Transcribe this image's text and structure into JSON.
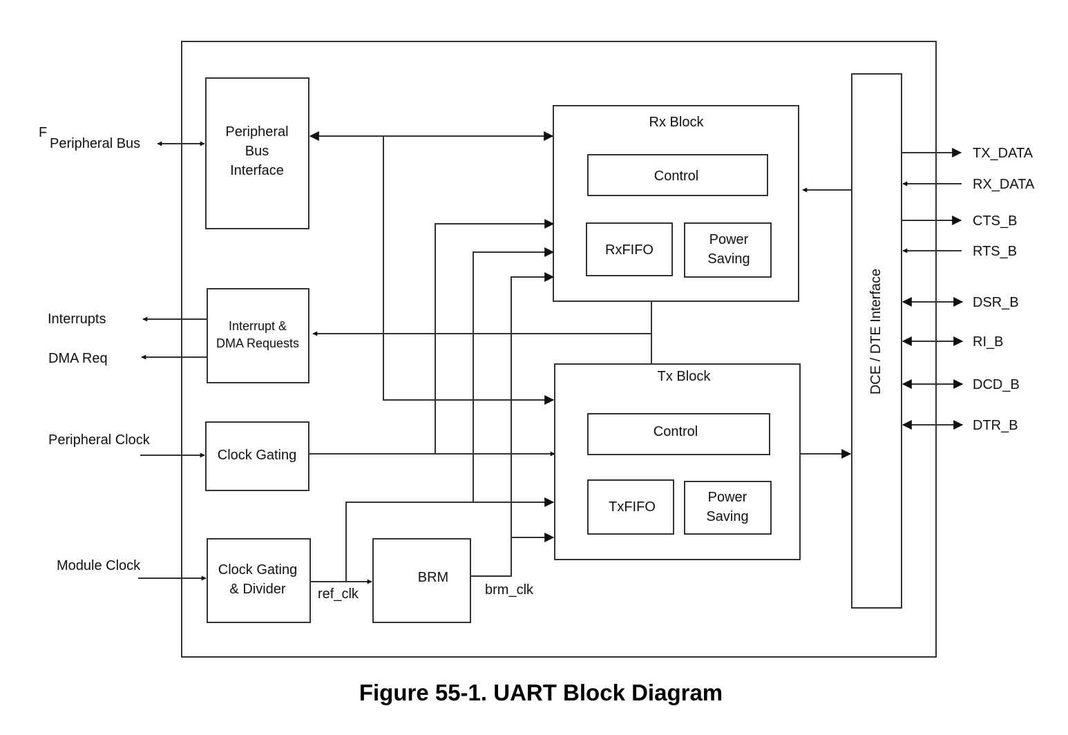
{
  "figure": {
    "caption": "Figure 55-1. UART Block Diagram",
    "stray_glyph": "F"
  },
  "external_signals_left": {
    "peripheral_bus": "Peripheral Bus",
    "interrupts": "Interrupts",
    "dma_req": "DMA Req",
    "peripheral_clock": "Peripheral Clock",
    "module_clock": "Module Clock"
  },
  "blocks": {
    "peripheral_bus_interface": [
      "Peripheral",
      "Bus",
      "Interface"
    ],
    "interrupt_dma": [
      "Interrupt &",
      "DMA Requests"
    ],
    "clock_gating": "Clock Gating",
    "clock_gating_divider": [
      "Clock Gating",
      "& Divider"
    ],
    "brm": "BRM",
    "rx_block": {
      "title": "Rx Block",
      "control": "Control",
      "fifo": "RxFIFO",
      "power_saving": [
        "Power",
        "Saving"
      ]
    },
    "tx_block": {
      "title": "Tx Block",
      "control": "Control",
      "fifo": "TxFIFO",
      "power_saving": [
        "Power",
        "Saving"
      ]
    },
    "dce_dte_interface": "DCE / DTE Interface"
  },
  "internal_signals": {
    "ref_clk": "ref_clk",
    "brm_clk": "brm_clk"
  },
  "external_signals_right": [
    {
      "name": "TX_DATA",
      "direction": "out"
    },
    {
      "name": "RX_DATA",
      "direction": "in"
    },
    {
      "name": "CTS_B",
      "direction": "out"
    },
    {
      "name": "RTS_B",
      "direction": "in"
    },
    {
      "name": "DSR_B",
      "direction": "bidir"
    },
    {
      "name": "RI_B",
      "direction": "bidir"
    },
    {
      "name": "DCD_B",
      "direction": "bidir"
    },
    {
      "name": "DTR_B",
      "direction": "bidir"
    }
  ]
}
